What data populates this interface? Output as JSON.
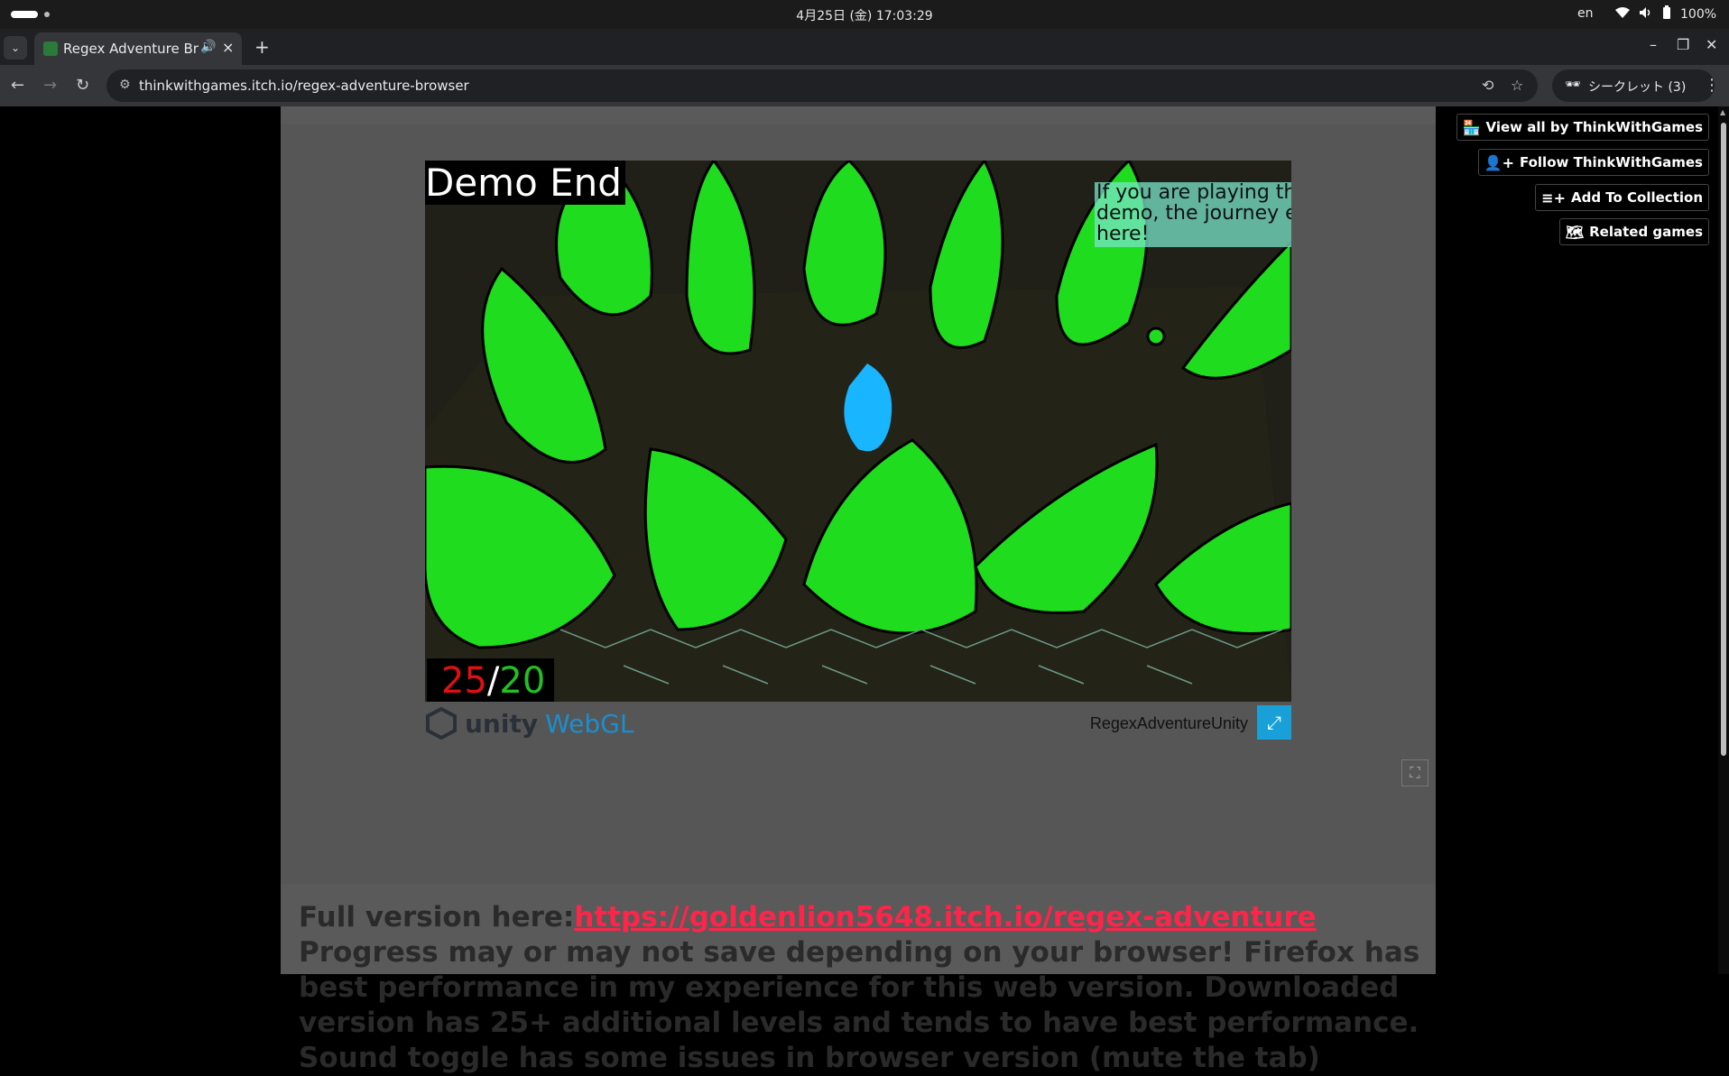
{
  "system_bar": {
    "datetime": "4月25日 (金)  17:03:29",
    "language": "en",
    "battery": "100%"
  },
  "browser": {
    "tab_title": "Regex Adventure Browser",
    "url": "thinkwithgames.itch.io/regex-adventure-browser",
    "incognito_label": "シークレット (3)"
  },
  "sidebar": {
    "view_all": "View all by ThinkWithGames",
    "follow": "Follow ThinkWithGames",
    "add_collection": "Add To Collection",
    "related": "Related games"
  },
  "game": {
    "title": "Demo End",
    "hint": "If you are playing the f\ndemo, the journey ends\nhere!",
    "score_current": "25",
    "score_sep": "/",
    "score_max": "20",
    "unity_label": "unity",
    "webgl_label": "WebGL",
    "build_name": "RegexAdventureUnity"
  },
  "description": {
    "lead": "Full version here:",
    "link": "https://goldenlion5648.itch.io/regex-adventure",
    "rest": " Progress may or may not save depending on your browser! Firefox has best performance in my experience for this web version. Downloaded version has 25+ additional levels and tends to have best performance. Sound toggle has some issues in browser version (mute the tab)"
  },
  "icons": [
    "wifi-icon",
    "volume-icon",
    "battery-icon",
    "back-icon",
    "forward-icon",
    "reload-icon",
    "translate-icon",
    "star-icon",
    "incognito-icon",
    "menu-icon",
    "fullscreen-icon"
  ]
}
